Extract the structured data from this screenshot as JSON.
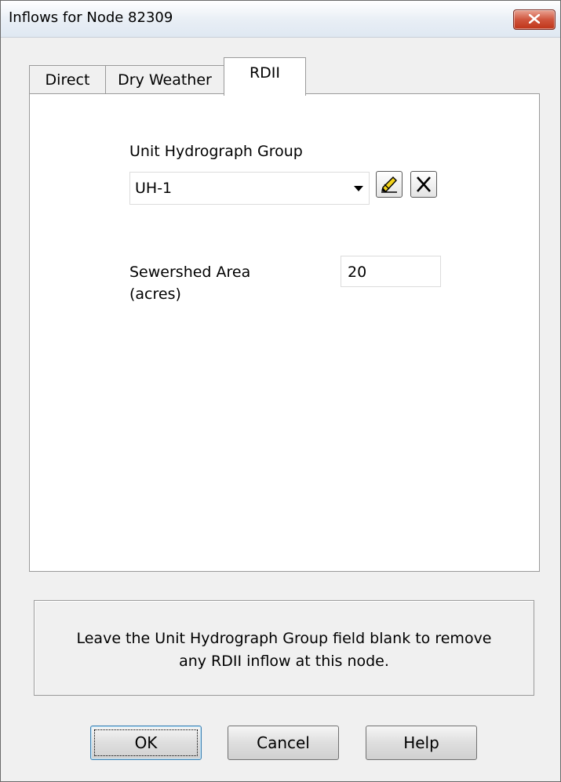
{
  "window": {
    "title": "Inflows for Node 82309"
  },
  "tabs": [
    {
      "label": "Direct"
    },
    {
      "label": "Dry Weather"
    },
    {
      "label": "RDII",
      "selected": true
    }
  ],
  "rdii": {
    "unit_hydrograph_label": "Unit Hydrograph Group",
    "unit_hydrograph_value": "UH-1",
    "sewershed_label_line1": "Sewershed Area",
    "sewershed_label_line2": "(acres)",
    "sewershed_value": "20"
  },
  "hint": {
    "line1": "Leave the Unit Hydrograph Group field blank to remove",
    "line2": "any RDII inflow at this node."
  },
  "buttons": {
    "ok": "OK",
    "cancel": "Cancel",
    "help": "Help"
  },
  "icons": {
    "close": "close-icon",
    "dropdown": "chevron-down-icon",
    "edit": "edit-pencil-icon",
    "delete": "delete-x-icon"
  },
  "colors": {
    "close_button": "#d0553d",
    "panel_background": "#ffffff",
    "dialog_background": "#f0f0f0"
  }
}
